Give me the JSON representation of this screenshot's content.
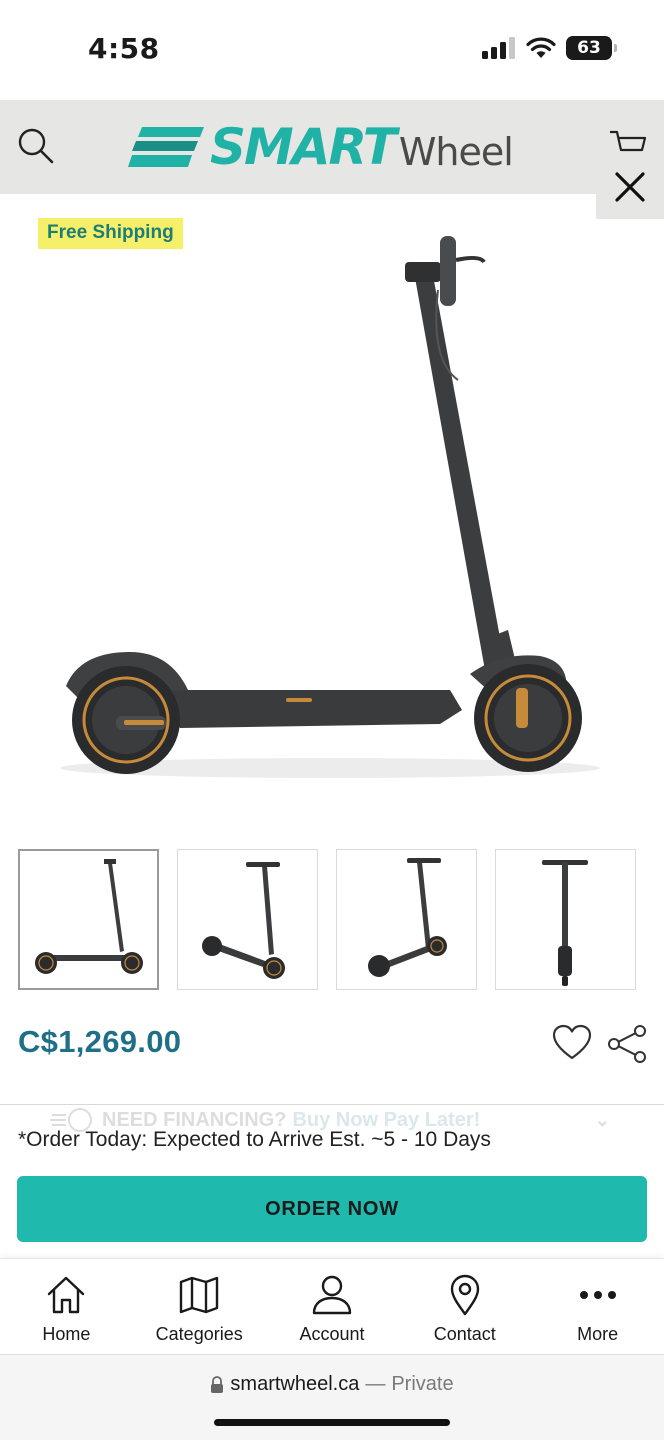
{
  "status_bar": {
    "time": "4:58",
    "battery_level": "63"
  },
  "header": {
    "logo_text_primary": "SMART",
    "logo_text_secondary": "Wheel",
    "icons": [
      "search-icon",
      "cart-icon",
      "close-icon"
    ]
  },
  "product": {
    "badge": "Free Shipping",
    "price": "C$1,269.00",
    "thumbnail_count": 4,
    "selected_thumbnail": 1
  },
  "financing": {
    "text": "NEED FINANCING?",
    "link": "Buy Now Pay Later!"
  },
  "arrival_note": "*Order Today: Expected to Arrive Est. ~5 - 10 Days",
  "order_button": "ORDER NOW",
  "bottom_nav": [
    {
      "label": "Home",
      "icon": "home-icon"
    },
    {
      "label": "Categories",
      "icon": "map-icon"
    },
    {
      "label": "Account",
      "icon": "user-icon"
    },
    {
      "label": "Contact",
      "icon": "location-pin-icon"
    },
    {
      "label": "More",
      "icon": "more-dots-icon"
    }
  ],
  "browser": {
    "domain": "smartwheel.ca",
    "separator": "—",
    "mode": "Private"
  },
  "colors": {
    "accent": "#1fb9ad",
    "price": "#1f6f86",
    "badge_bg": "#f5ef6a",
    "header_bg": "#e6e6e4"
  }
}
